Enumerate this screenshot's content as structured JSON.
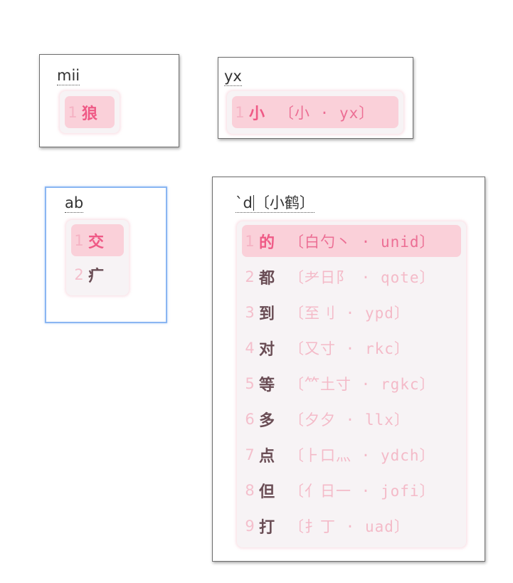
{
  "windows": {
    "mii": {
      "input": "mii",
      "candidates": [
        {
          "index": "1",
          "text": "狼",
          "comment": ""
        }
      ]
    },
    "yx": {
      "input": "yx",
      "candidates": [
        {
          "index": "1",
          "text": "小",
          "comment": "〔小 · yx〕"
        }
      ]
    },
    "ab": {
      "input": "ab",
      "candidates": [
        {
          "index": "1",
          "text": "交",
          "comment": ""
        },
        {
          "index": "2",
          "text": "疒",
          "comment": ""
        }
      ]
    },
    "d": {
      "input_before_caret": "`d",
      "input_after_caret": "〔小鹤〕",
      "candidates": [
        {
          "index": "1",
          "text": "的",
          "comment": "〔白勺丶 · unid〕"
        },
        {
          "index": "2",
          "text": "都",
          "comment": "〔耂日阝 · qote〕"
        },
        {
          "index": "3",
          "text": "到",
          "comment": "〔至刂 · ypd〕"
        },
        {
          "index": "4",
          "text": "对",
          "comment": "〔又寸 · rkc〕"
        },
        {
          "index": "5",
          "text": "等",
          "comment": "〔⺮土寸 · rgkc〕"
        },
        {
          "index": "6",
          "text": "多",
          "comment": "〔夕夕 · llx〕"
        },
        {
          "index": "7",
          "text": "点",
          "comment": "〔⺊口灬 · ydch〕"
        },
        {
          "index": "8",
          "text": "但",
          "comment": "〔亻日一 · jofi〕"
        },
        {
          "index": "9",
          "text": "打",
          "comment": "〔扌丁 · uad〕"
        }
      ]
    }
  },
  "colors": {
    "highlight_bg": "#fad0d9",
    "highlight_text": "#ef5a86",
    "panel_bg": "#f7f3f5",
    "index_color": "#f4bfcc",
    "candidate_text": "#6a4d55",
    "focus_border": "#8ab6f2"
  }
}
